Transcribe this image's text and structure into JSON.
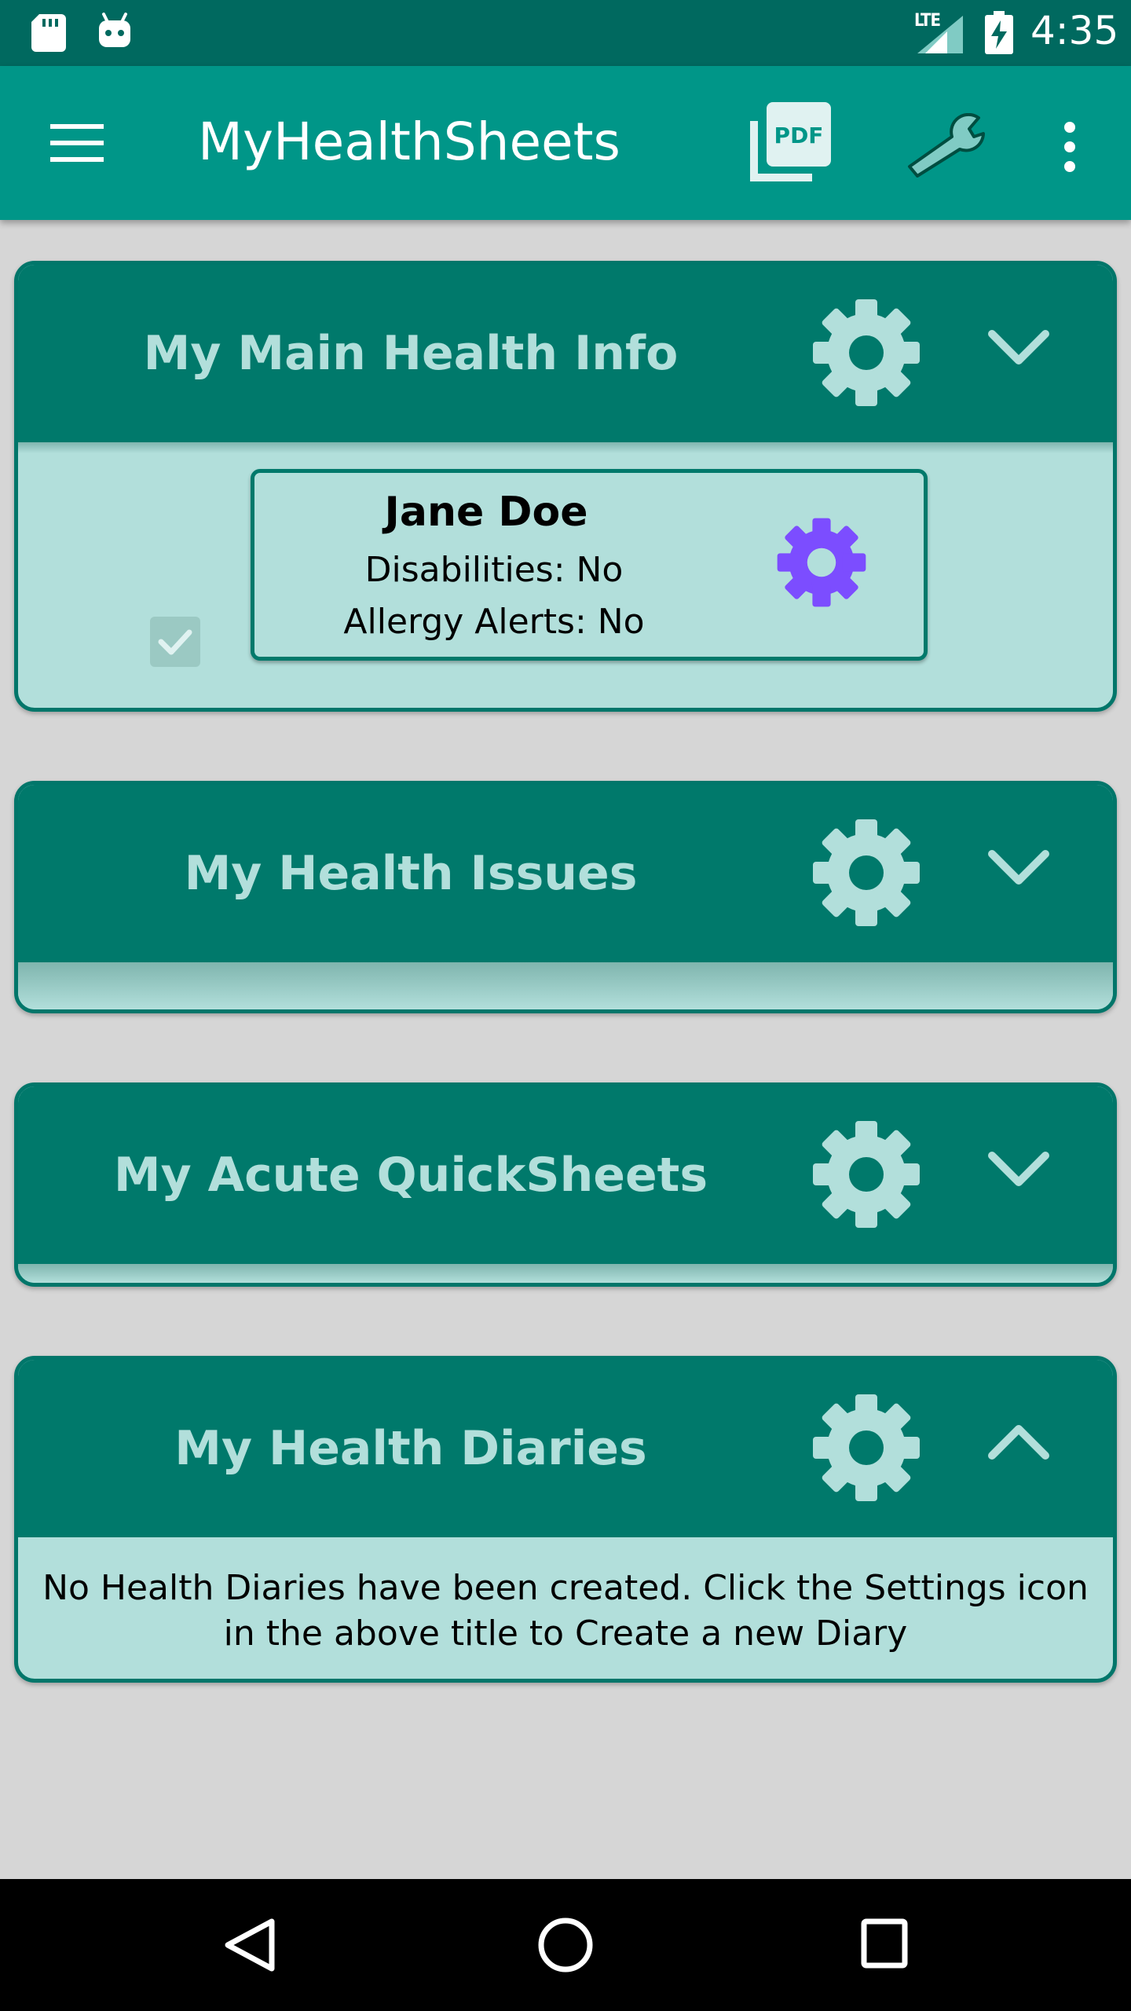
{
  "status_bar": {
    "network_label": "LTE",
    "time": "4:35",
    "icons": [
      "sd-card-icon",
      "android-icon",
      "signal-icon",
      "battery-charging-icon"
    ]
  },
  "app_bar": {
    "title": "MyHealthSheets",
    "actions": [
      "menu-icon",
      "pdf-icon",
      "wrench-icon",
      "overflow-menu-icon"
    ],
    "color": "#009688"
  },
  "cards": {
    "main_info": {
      "title": "My Main Health Info",
      "expanded": true,
      "profile": {
        "name": "Jane Doe",
        "disabilities": "Disabilities: No",
        "allergy_alerts": "Allergy Alerts: No",
        "checked": true
      }
    },
    "health_issues": {
      "title": "My Health Issues",
      "expanded": false
    },
    "acute_quicksheets": {
      "title": "My Acute QuickSheets",
      "expanded": false
    },
    "health_diaries": {
      "title": "My Health Diaries",
      "expanded": true,
      "empty_message": "No Health Diaries have been created.  Click the Settings icon in the above title to Create a new Diary"
    }
  },
  "colors": {
    "primary_dark": "#00695f",
    "card_header": "#00796b",
    "card_body": "#b2dfdb",
    "accent_gear": "#7c4dff",
    "background": "#d6d6d6"
  }
}
